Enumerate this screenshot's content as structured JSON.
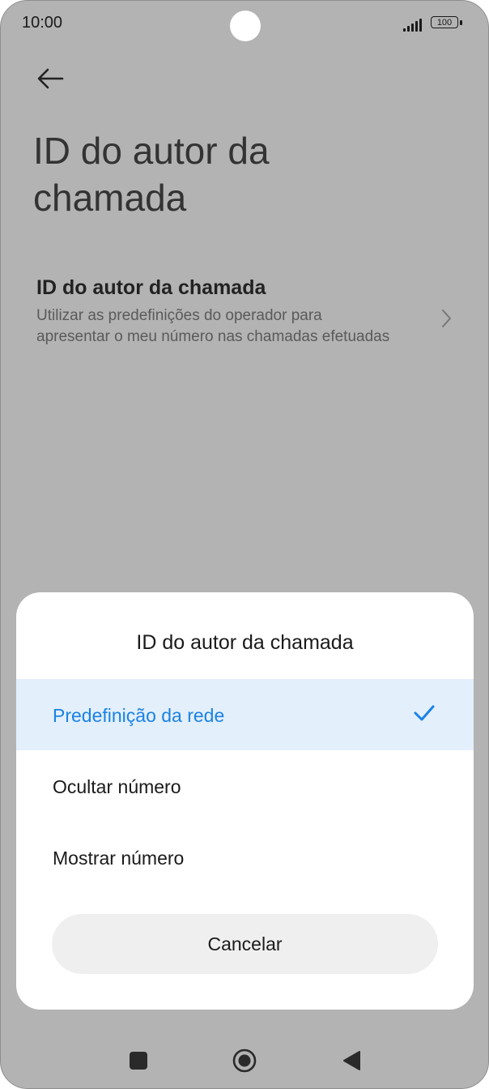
{
  "status_bar": {
    "time": "10:00",
    "battery": "100"
  },
  "page": {
    "title": "ID do autor da chamada"
  },
  "setting": {
    "title": "ID do autor da chamada",
    "subtitle": "Utilizar as predefinições do operador para apresentar o meu número nas chamadas efetuadas"
  },
  "dialog": {
    "title": "ID do autor da chamada",
    "options": [
      {
        "label": "Predefinição da rede",
        "selected": true
      },
      {
        "label": "Ocultar número",
        "selected": false
      },
      {
        "label": "Mostrar número",
        "selected": false
      }
    ],
    "cancel_label": "Cancelar"
  },
  "icons": {
    "back": "arrow-left-icon",
    "chevron": "chevron-right-icon",
    "check": "checkmark-icon",
    "nav_recents": "square-icon",
    "nav_home": "circle-icon",
    "nav_back": "triangle-back-icon"
  },
  "colors": {
    "accent": "#1a82e6",
    "selected_bg": "#e3effb",
    "scrim": "#b3b3b3"
  }
}
